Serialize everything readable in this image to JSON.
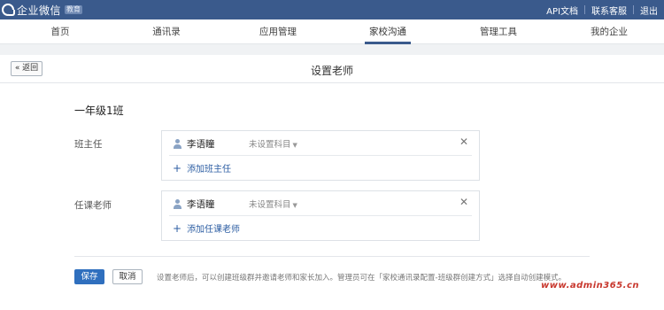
{
  "topbar": {
    "logo_text": "企业微信",
    "logo_badge": "教育",
    "links": [
      "API文档",
      "联系客服",
      "退出"
    ]
  },
  "nav": {
    "items": [
      "首页",
      "通讯录",
      "应用管理",
      "家校沟通",
      "管理工具",
      "我的企业"
    ],
    "active": "家校沟通"
  },
  "page": {
    "back_label": "« 返回",
    "title": "设置老师",
    "class_name": "一年级1班"
  },
  "head_teacher": {
    "label": "班主任",
    "name": "李语瞳",
    "subject": "未设置科目",
    "add_label": "添加班主任"
  },
  "subject_teacher": {
    "label": "任课老师",
    "name": "李语瞳",
    "subject": "未设置科目",
    "add_label": "添加任课老师"
  },
  "actions": {
    "save_label": "保存",
    "cancel_label": "取消",
    "hint": "设置老师后，可以创建班级群并邀请老师和家长加入。管理员可在「家校通讯录配置-班级群创建方式」选择自动创建模式。"
  },
  "watermark": "www.admin365.cn",
  "colors": {
    "topbar": "#3a5a8c",
    "primary": "#2f6fbe",
    "link": "#2d5ea3"
  }
}
